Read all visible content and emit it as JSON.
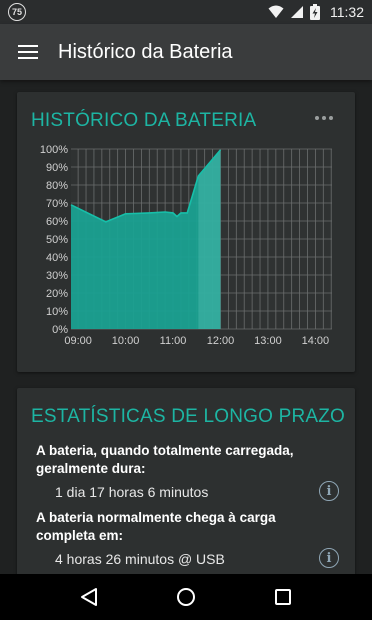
{
  "status_bar": {
    "badge": "75",
    "time": "11:32",
    "icons": [
      "wifi-icon",
      "signal-icon",
      "battery-charging-icon"
    ]
  },
  "app_bar": {
    "title": "Histórico da Bateria",
    "menu_icon": "hamburger-menu-icon"
  },
  "history_card": {
    "title": "HISTÓRICO DA BATERIA",
    "more_icon": "more-horizontal-icon"
  },
  "chart_data": {
    "type": "area",
    "title": "",
    "xlabel": "",
    "ylabel": "",
    "x_ticks": [
      "09:00",
      "10:00",
      "11:00",
      "12:00",
      "13:00",
      "14:00"
    ],
    "y_ticks": [
      "0%",
      "10%",
      "20%",
      "30%",
      "40%",
      "50%",
      "60%",
      "70%",
      "80%",
      "90%",
      "100%"
    ],
    "ylim": [
      0,
      100
    ],
    "xlim_hours": [
      8.85,
      14.35
    ],
    "series": [
      {
        "color": "#1aa191",
        "points": [
          {
            "t": "08:51",
            "v": 69
          },
          {
            "t": "09:35",
            "v": 59.5
          },
          {
            "t": "10:00",
            "v": 64
          },
          {
            "t": "10:30",
            "v": 64.5
          },
          {
            "t": "10:50",
            "v": 65
          },
          {
            "t": "11:00",
            "v": 64.5
          },
          {
            "t": "11:05",
            "v": 62.5
          },
          {
            "t": "11:10",
            "v": 64.5
          },
          {
            "t": "11:18",
            "v": 64.5
          },
          {
            "t": "11:32",
            "v": 85
          },
          {
            "t": "12:00",
            "v": 99.5
          }
        ]
      }
    ],
    "now_marker": "11:32",
    "grid": true
  },
  "stats_card": {
    "title": "ESTATÍSTICAS DE LONGO PRAZO",
    "items": [
      {
        "label": "A bateria, quando totalmente carregada, geralmente dura:",
        "value": "1 dia 17 horas 6 minutos"
      },
      {
        "label": "A bateria normalmente chega à carga completa em:",
        "value": "4 horas 26 minutos @ USB"
      }
    ],
    "info_glyph": "i"
  },
  "nav_bar": {
    "icons": [
      "back-icon",
      "home-icon",
      "recents-icon"
    ]
  }
}
